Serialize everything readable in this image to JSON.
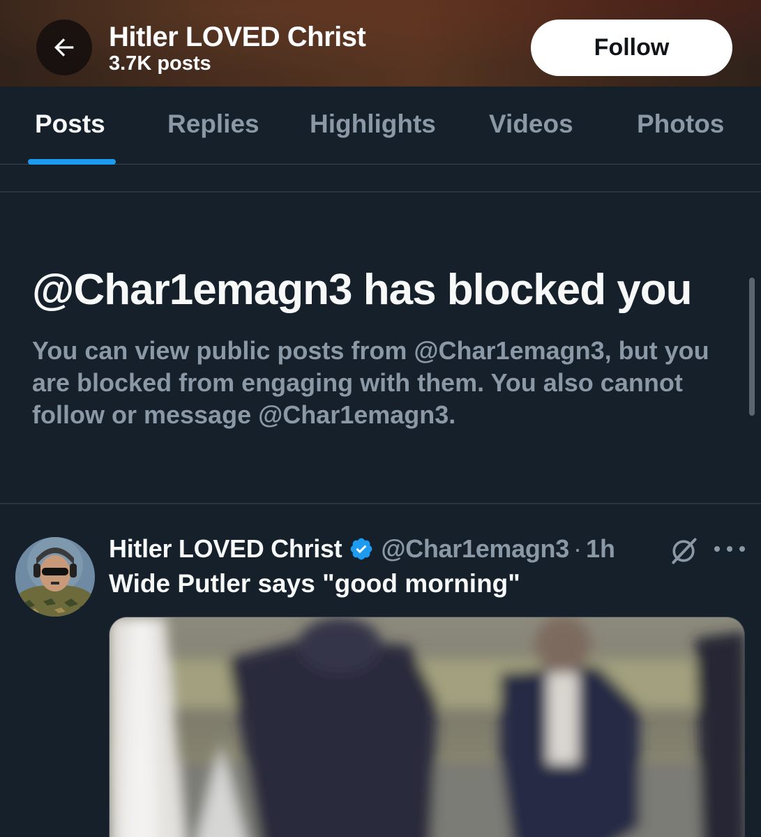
{
  "header": {
    "back_icon": "arrow-left-icon",
    "title": "Hitler LOVED Christ",
    "subtitle": "3.7K posts",
    "follow_label": "Follow"
  },
  "tabs": [
    {
      "label": "Posts",
      "active": true
    },
    {
      "label": "Replies",
      "active": false
    },
    {
      "label": "Highlights",
      "active": false
    },
    {
      "label": "Videos",
      "active": false
    },
    {
      "label": "Photos",
      "active": false
    }
  ],
  "blocked": {
    "title": "@Char1emagn3 has blocked you",
    "description": "You can view public posts from @Char1emagn3, but you are blocked from engaging with them. You also cannot follow or message @Char1emagn3."
  },
  "post": {
    "display_name": "Hitler LOVED Christ",
    "verified_icon": "verified-badge-icon",
    "handle": "@Char1emagn3",
    "separator": "·",
    "time": "1h",
    "grok_icon": "grok-icon",
    "more_icon": "more-icon",
    "text": "Wide Putler says \"good morning\""
  },
  "colors": {
    "background": "#15202b",
    "accent": "#1d9bf0",
    "secondary_text": "#8b98a5",
    "primary_text": "#f7f9f9"
  }
}
